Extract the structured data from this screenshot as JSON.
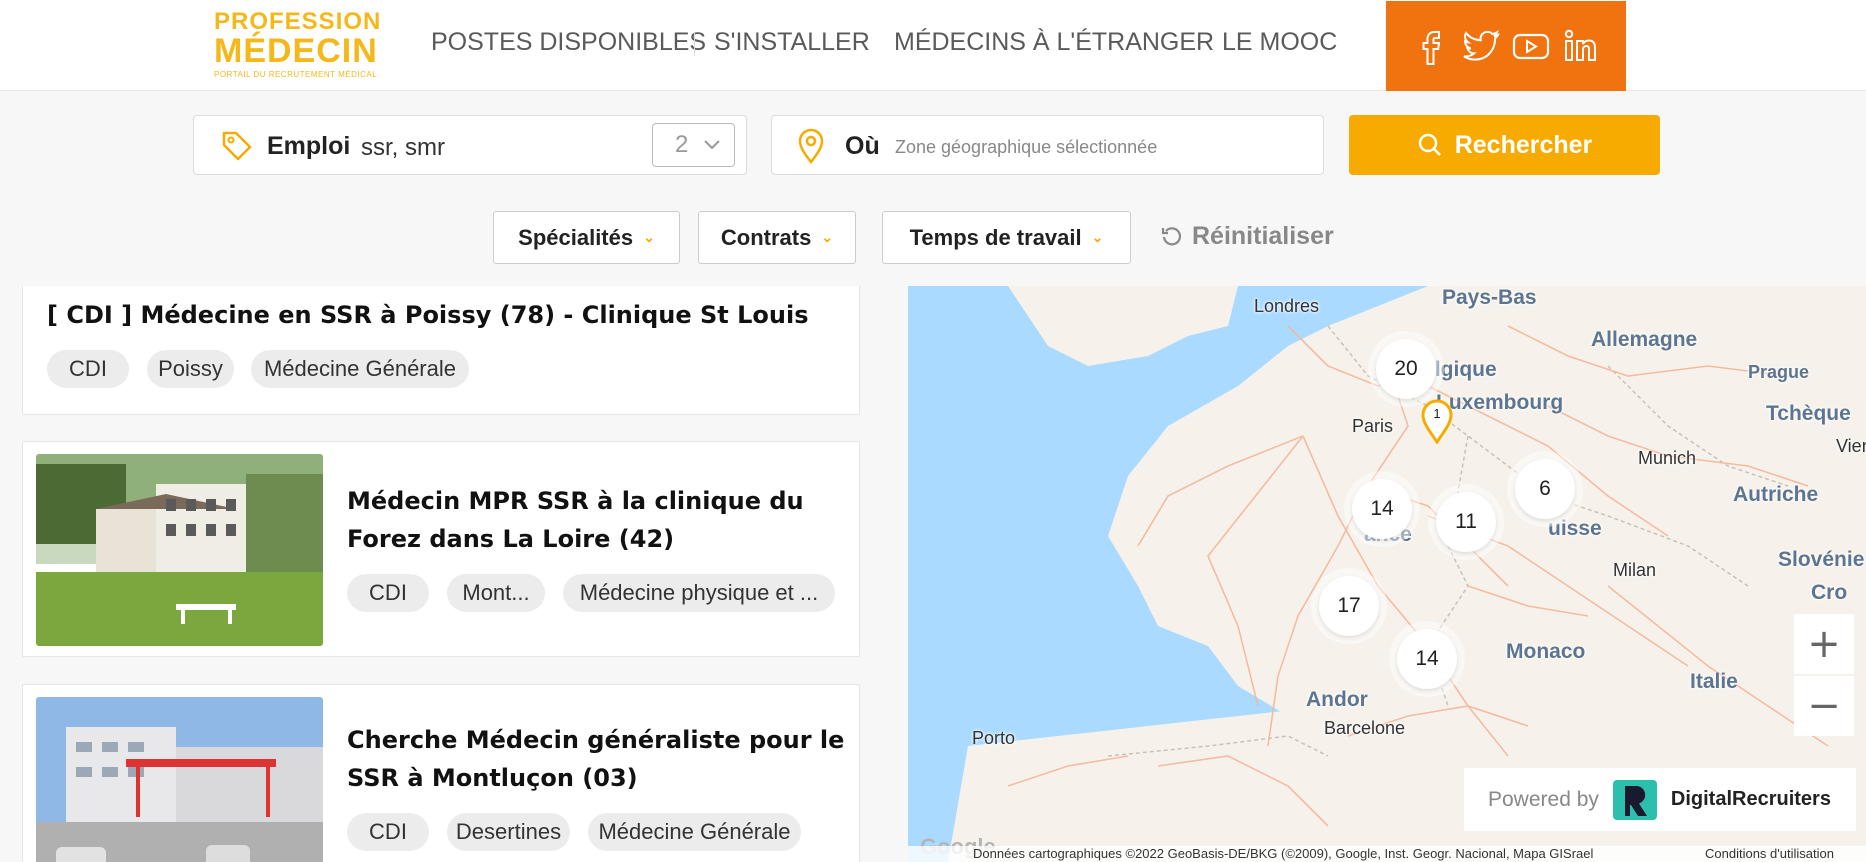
{
  "header": {
    "logo": {
      "line1": "PROFESSION",
      "line2": "MÉDECIN",
      "tagline": "PORTAIL DU RECRUTEMENT MÉDICAL"
    },
    "nav": [
      "POSTES DISPONIBLES",
      "S'INSTALLER",
      "MÉDECINS À L'ÉTRANGER",
      "LE MOOC"
    ],
    "social": [
      "facebook-icon",
      "twitter-icon",
      "youtube-icon",
      "linkedin-icon"
    ]
  },
  "search": {
    "emploi_label": "Emploi",
    "emploi_value": "ssr, smr",
    "emploi_count": "2",
    "ou_label": "Où",
    "ou_placeholder": "Zone géographique sélectionnée",
    "button": "Rechercher"
  },
  "filters": {
    "specialites": "Spécialités",
    "contrats": "Contrats",
    "temps": "Temps de travail",
    "reset": "Réinitialiser"
  },
  "jobs": [
    {
      "title": "[ CDI ] Médecine en SSR à Poissy (78) - Clinique St Louis",
      "tags": [
        "CDI",
        "Poissy",
        "Médecine Générale"
      ]
    },
    {
      "title_line1": "Médecin MPR SSR à la clinique du",
      "title_line2": "Forez dans La Loire (42)",
      "tags": [
        "CDI",
        "Mont...",
        "Médecine physique et ..."
      ]
    },
    {
      "title_line1": "Cherche Médecin généraliste pour le",
      "title_line2": "SSR à Montluçon (03)",
      "tags": [
        "CDI",
        "Desertines",
        "Médecine Générale"
      ]
    }
  ],
  "map": {
    "clusters": [
      "20",
      "14",
      "11",
      "6",
      "17",
      "14"
    ],
    "marker": "1",
    "labels": {
      "pays_bas": "Pays-Bas",
      "londres": "Londres",
      "belgique": "Belgique",
      "allemagne": "Allemagne",
      "luxembourg": "Luxembourg",
      "prague": "Prague",
      "tcheque": "Tchèque",
      "paris": "Paris",
      "munich": "Munich",
      "vien": "Vien",
      "autriche": "Autriche",
      "suisse": "uisse",
      "france": "ance",
      "milan": "Milan",
      "slovenie": "Slovénie",
      "cro": "Cro",
      "monaco": "Monaco",
      "italie": "Italie",
      "andorre": "Andor",
      "barcelone": "Barcelone",
      "porto": "Porto"
    },
    "powered_by": "Powered by",
    "brand": "DigitalRecruiters",
    "attribution": "Données cartographiques ©2022 GeoBasis-DE/BKG (©2009), Google, Inst. Geogr. Nacional, Mapa GISrael",
    "terms": "Conditions d'utilisation",
    "google": "Google"
  },
  "colors": {
    "brand_yellow": "#f5b81b",
    "accent_orange": "#f0730f",
    "search_button": "#f7ab00"
  }
}
